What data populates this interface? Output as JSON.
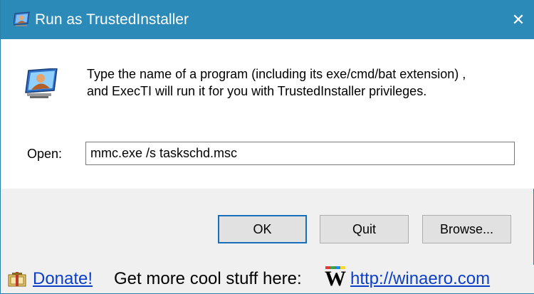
{
  "window": {
    "title": "Run as TrustedInstaller",
    "close_glyph": "✕"
  },
  "dialog": {
    "description_line1": "Type the name of a program (including its exe/cmd/bat extension) ,",
    "description_line2": "and ExecTI will run it for you with TrustedInstaller privileges.",
    "open_label": "Open:",
    "open_value": "mmc.exe /s taskschd.msc"
  },
  "buttons": {
    "ok": "OK",
    "quit": "Quit",
    "browse": "Browse..."
  },
  "footer": {
    "donate": "Donate!",
    "promo_text": "Get more cool stuff here:",
    "logo_letter": "W",
    "site_link": "http://winaero.com"
  },
  "colors": {
    "titlebar": "#2b8ab7",
    "link": "#0b3fc8",
    "default_button_border": "#1a6fbd"
  },
  "icons": {
    "title": "trustedinstaller-app-icon",
    "dialog": "user-monitor-icon",
    "footer": "donate-gift-icon",
    "logo": "winaero-w-logo"
  }
}
